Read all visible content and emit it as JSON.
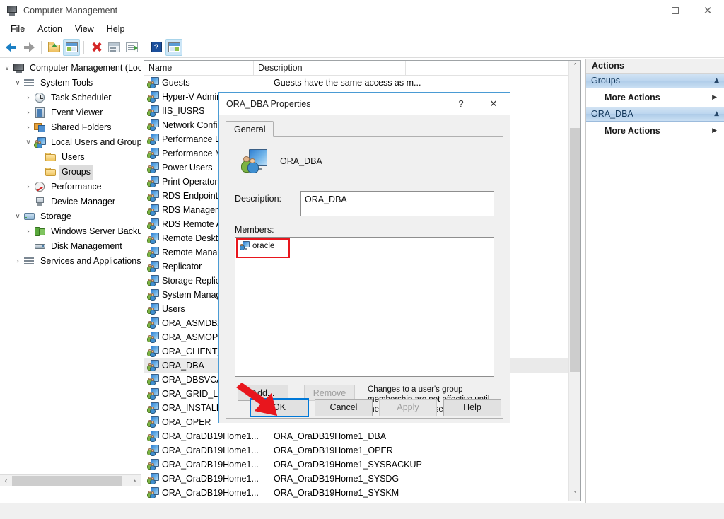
{
  "window": {
    "title": "Computer Management",
    "icon": "computer-management-icon",
    "minimize_label": "–",
    "maximize_label": "□",
    "close_label": "✕"
  },
  "menu": {
    "items": [
      "File",
      "Action",
      "View",
      "Help"
    ]
  },
  "toolbar": {
    "buttons": [
      {
        "name": "back-icon",
        "title": "Back"
      },
      {
        "name": "forward-icon",
        "title": "Forward"
      },
      {
        "name": "up-one-level-icon",
        "title": "Up One Level"
      },
      {
        "name": "show-hide-console-tree-icon",
        "title": "Show/Hide Console Tree"
      },
      {
        "name": "delete-icon",
        "title": "Delete"
      },
      {
        "name": "properties-icon",
        "title": "Properties"
      },
      {
        "name": "export-list-icon",
        "title": "Export List"
      },
      {
        "name": "help-icon",
        "title": "Help"
      },
      {
        "name": "show-hide-action-pane-icon",
        "title": "Show/Hide Action Pane"
      }
    ]
  },
  "tree": {
    "nodes": [
      {
        "label": "Computer Management (Local",
        "indent": 0,
        "chevron": "v",
        "icon": "computer-management-icon",
        "selected": false
      },
      {
        "label": "System Tools",
        "indent": 1,
        "chevron": "v",
        "icon": "system-tools-icon",
        "selected": false
      },
      {
        "label": "Task Scheduler",
        "indent": 2,
        "chevron": ">",
        "icon": "task-scheduler-icon",
        "selected": false
      },
      {
        "label": "Event Viewer",
        "indent": 2,
        "chevron": ">",
        "icon": "event-viewer-icon",
        "selected": false
      },
      {
        "label": "Shared Folders",
        "indent": 2,
        "chevron": ">",
        "icon": "shared-folders-icon",
        "selected": false
      },
      {
        "label": "Local Users and Groups",
        "indent": 2,
        "chevron": "v",
        "icon": "local-users-and-groups-icon",
        "selected": false
      },
      {
        "label": "Users",
        "indent": 3,
        "chevron": "",
        "icon": "folder-icon",
        "selected": false
      },
      {
        "label": "Groups",
        "indent": 3,
        "chevron": "",
        "icon": "folder-icon",
        "selected": true
      },
      {
        "label": "Performance",
        "indent": 2,
        "chevron": ">",
        "icon": "performance-icon",
        "selected": false
      },
      {
        "label": "Device Manager",
        "indent": 2,
        "chevron": "",
        "icon": "device-manager-icon",
        "selected": false
      },
      {
        "label": "Storage",
        "indent": 1,
        "chevron": "v",
        "icon": "storage-icon",
        "selected": false
      },
      {
        "label": "Windows Server Backup",
        "indent": 2,
        "chevron": ">",
        "icon": "windows-server-backup-icon",
        "selected": false
      },
      {
        "label": "Disk Management",
        "indent": 2,
        "chevron": "",
        "icon": "disk-management-icon",
        "selected": false
      },
      {
        "label": "Services and Applications",
        "indent": 1,
        "chevron": ">",
        "icon": "services-and-applications-icon",
        "selected": false
      }
    ],
    "hscroll": {
      "left_arrow": "‹",
      "right_arrow": "›"
    }
  },
  "list": {
    "columns": [
      "Name",
      "Description",
      ""
    ],
    "rows": [
      {
        "name": "Guests",
        "desc": "Guests have the same access as m...",
        "selected": false
      },
      {
        "name": "Hyper-V Administrators",
        "desc": "",
        "selected": false
      },
      {
        "name": "IIS_IUSRS",
        "desc": "",
        "selected": false
      },
      {
        "name": "Network Configuration Operators",
        "desc": "",
        "selected": false
      },
      {
        "name": "Performance Log Users",
        "desc": "",
        "selected": false
      },
      {
        "name": "Performance Monitor Users",
        "desc": "",
        "selected": false
      },
      {
        "name": "Power Users",
        "desc": "",
        "selected": false
      },
      {
        "name": "Print Operators",
        "desc": "",
        "selected": false
      },
      {
        "name": "RDS Endpoint Servers",
        "desc": "",
        "selected": false
      },
      {
        "name": "RDS Management Servers",
        "desc": "",
        "selected": false
      },
      {
        "name": "RDS Remote Access Servers",
        "desc": "",
        "selected": false
      },
      {
        "name": "Remote Desktop Users",
        "desc": "",
        "selected": false
      },
      {
        "name": "Remote Management Users",
        "desc": "",
        "selected": false
      },
      {
        "name": "Replicator",
        "desc": "",
        "selected": false
      },
      {
        "name": "Storage Replica Administrators",
        "desc": "",
        "selected": false
      },
      {
        "name": "System Managed Accounts Group",
        "desc": "",
        "selected": false
      },
      {
        "name": "Users",
        "desc": "",
        "selected": false
      },
      {
        "name": "ORA_ASMDBA",
        "desc": "",
        "selected": false
      },
      {
        "name": "ORA_ASMOPER",
        "desc": "",
        "selected": false
      },
      {
        "name": "ORA_CLIENT_LISTENERS",
        "desc": "",
        "selected": false
      },
      {
        "name": "ORA_DBA",
        "desc": "",
        "selected": true
      },
      {
        "name": "ORA_DBSVCACCTS",
        "desc": "",
        "selected": false
      },
      {
        "name": "ORA_GRID_LISTENERS",
        "desc": "",
        "selected": false
      },
      {
        "name": "ORA_INSTALL",
        "desc": "",
        "selected": false
      },
      {
        "name": "ORA_OPER",
        "desc": "",
        "selected": false
      },
      {
        "name": "ORA_OraDB19Home1...",
        "desc": "ORA_OraDB19Home1_DBA",
        "selected": false
      },
      {
        "name": "ORA_OraDB19Home1...",
        "desc": "ORA_OraDB19Home1_OPER",
        "selected": false
      },
      {
        "name": "ORA_OraDB19Home1...",
        "desc": "ORA_OraDB19Home1_SYSBACKUP",
        "selected": false
      },
      {
        "name": "ORA_OraDB19Home1...",
        "desc": "ORA_OraDB19Home1_SYSDG",
        "selected": false
      },
      {
        "name": "ORA_OraDB19Home1...",
        "desc": "ORA_OraDB19Home1_SYSKM",
        "selected": false
      }
    ],
    "vscroll": {
      "up_arrow": "˄",
      "down_arrow": "˅"
    }
  },
  "actions": {
    "title": "Actions",
    "groups": [
      {
        "header": "Groups",
        "caret": "▲",
        "items": [
          {
            "label": "More Actions",
            "arrow": "▶"
          }
        ]
      },
      {
        "header": "ORA_DBA",
        "caret": "▲",
        "items": [
          {
            "label": "More Actions",
            "arrow": "▶"
          }
        ]
      }
    ]
  },
  "dialog": {
    "title": "ORA_DBA Properties",
    "help_label": "?",
    "close_label": "✕",
    "tabs": [
      {
        "label": "General",
        "active": true
      }
    ],
    "group_name": "ORA_DBA",
    "group_icon": "group-icon",
    "description_label": "Description:",
    "description_value": "ORA_DBA",
    "members_label": "Members:",
    "members": [
      {
        "name": "oracle",
        "icon": "user-icon",
        "highlighted": true
      }
    ],
    "add_label": "Add...",
    "remove_label": "Remove",
    "remove_disabled": true,
    "hint": "Changes to a user's group membership are not effective until the next time the user logs on.",
    "ok_label": "OK",
    "cancel_label": "Cancel",
    "apply_label": "Apply",
    "apply_disabled": true,
    "help_button_label": "Help"
  },
  "annotations": {
    "member_highlight_color": "#e8161d",
    "arrow_color": "#e8161d",
    "ok_focus_color": "#0078d7"
  }
}
